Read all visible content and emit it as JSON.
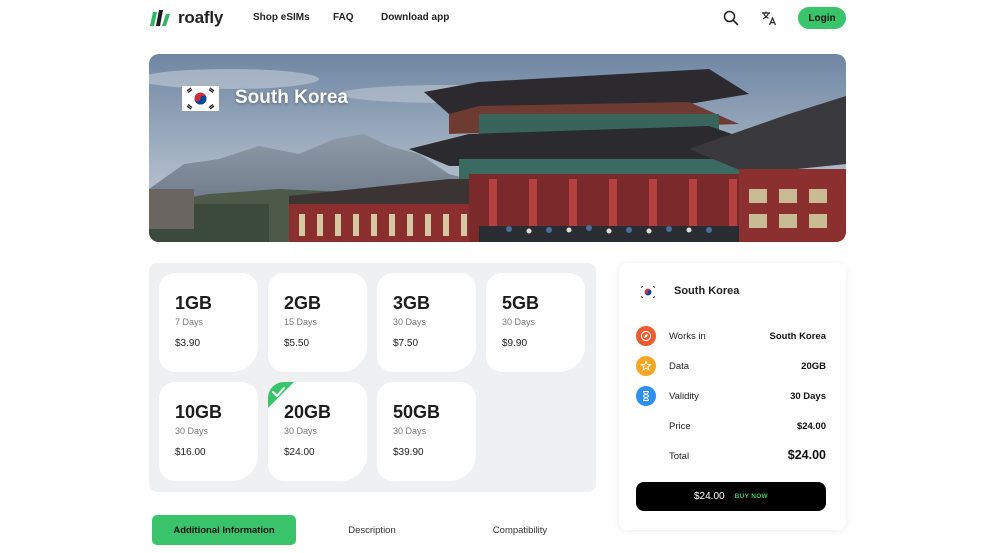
{
  "brand": {
    "name": "roafly",
    "accent": "#39c46b"
  },
  "nav": {
    "items": [
      "Shop eSIMs",
      "FAQ",
      "Download app"
    ],
    "login_label": "Login"
  },
  "header_icons": [
    "search-icon",
    "translate-icon"
  ],
  "hero": {
    "country": "South Korea"
  },
  "plans": [
    {
      "data": "1GB",
      "validity": "7 Days",
      "price": "$3.90",
      "selected": false
    },
    {
      "data": "2GB",
      "validity": "15 Days",
      "price": "$5.50",
      "selected": false
    },
    {
      "data": "3GB",
      "validity": "30 Days",
      "price": "$7.50",
      "selected": false
    },
    {
      "data": "5GB",
      "validity": "30 Days",
      "price": "$9.90",
      "selected": false
    },
    {
      "data": "10GB",
      "validity": "30 Days",
      "price": "$16.00",
      "selected": false
    },
    {
      "data": "20GB",
      "validity": "30 Days",
      "price": "$24.00",
      "selected": true
    },
    {
      "data": "50GB",
      "validity": "30 Days",
      "price": "$39.90",
      "selected": false
    }
  ],
  "tabs": [
    "Additional Information",
    "Description",
    "Compatibility"
  ],
  "summary": {
    "country": "South Korea",
    "rows": [
      {
        "label": "Works in",
        "value": "South Korea",
        "icon": "compass-icon",
        "color": "#f0582d"
      },
      {
        "label": "Data",
        "value": "20GB",
        "icon": "star-icon",
        "color": "#f6a623"
      },
      {
        "label": "Validity",
        "value": "30 Days",
        "icon": "hourglass-icon",
        "color": "#2f8ff0"
      },
      {
        "label": "Price",
        "value": "$24.00"
      },
      {
        "label": "Total",
        "value": "$24.00"
      }
    ],
    "buy_amount": "$24.00",
    "buy_label": "BUY NOW"
  }
}
